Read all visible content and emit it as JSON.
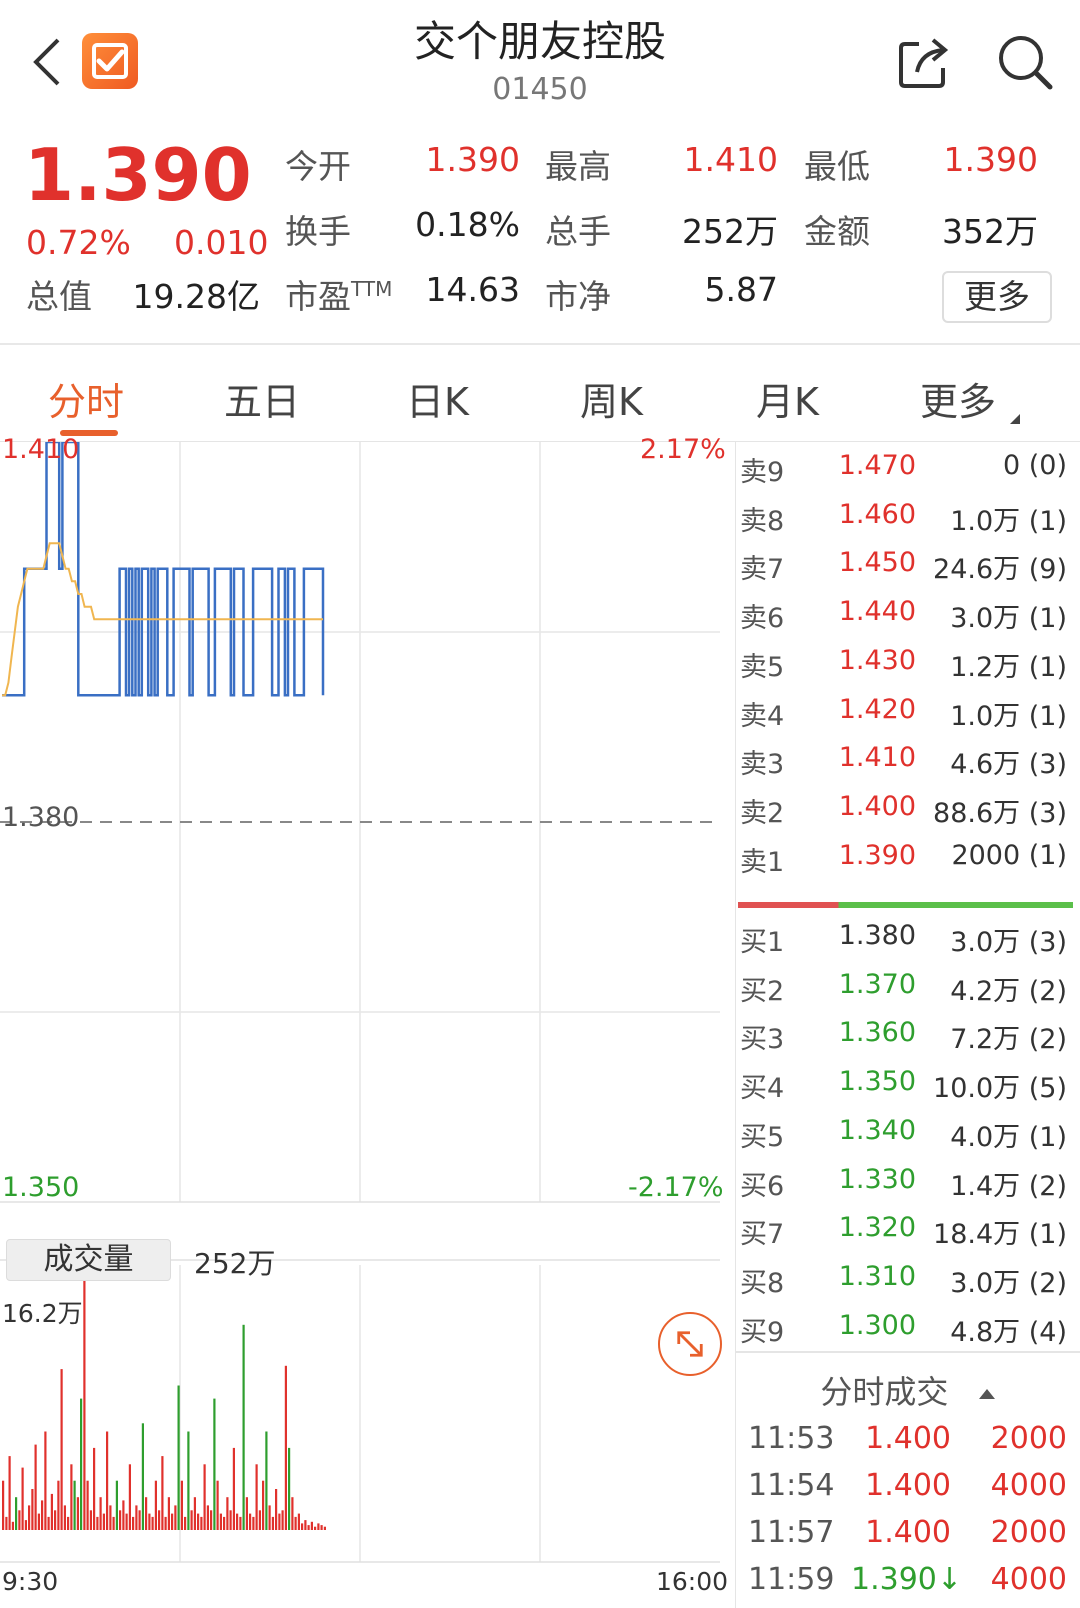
{
  "header": {
    "title": "交个朋友控股",
    "code": "01450"
  },
  "quote": {
    "price": "1.390",
    "change_pct": "0.72%",
    "change": "0.010",
    "fields": [
      {
        "label": "今开",
        "value": "1.390",
        "color": "red"
      },
      {
        "label": "最高",
        "value": "1.410",
        "color": "red"
      },
      {
        "label": "最低",
        "value": "1.390",
        "color": "red"
      },
      {
        "label": "换手",
        "value": "0.18%",
        "color": "dark"
      },
      {
        "label": "总手",
        "value": "252万",
        "color": "dark"
      },
      {
        "label": "金额",
        "value": "352万",
        "color": "dark"
      },
      {
        "label": "总值",
        "value": "19.28亿",
        "color": "dark"
      },
      {
        "label": "市盈TTM",
        "value": "14.63",
        "color": "dark"
      },
      {
        "label": "市净",
        "value": "5.87",
        "color": "dark"
      }
    ],
    "more_label": "更多"
  },
  "tabs": [
    "分时",
    "五日",
    "日K",
    "周K",
    "月K",
    "更多"
  ],
  "chart": {
    "price_high": "1.410",
    "price_mid": "1.380",
    "price_low": "1.350",
    "pct_high": "2.17%",
    "pct_low": "-2.17%",
    "volume_label": "成交量",
    "volume_total": "252万",
    "volume_max": "16.2万",
    "time_start": "9:30",
    "time_end": "16:00"
  },
  "chart_data": {
    "type": "line",
    "ylim": [
      1.35,
      1.41
    ],
    "series": [
      {
        "values": [
          1.39,
          1.39,
          1.39,
          1.39,
          1.39,
          1.39,
          1.39,
          1.4,
          1.4,
          1.4,
          1.4,
          1.4,
          1.4,
          1.4,
          1.41,
          1.41,
          1.41,
          1.41,
          1.4,
          1.41,
          1.41,
          1.41,
          1.41,
          1.41,
          1.39,
          1.39,
          1.39,
          1.39,
          1.39,
          1.39,
          1.39,
          1.39,
          1.39,
          1.39,
          1.39,
          1.39,
          1.39,
          1.4,
          1.4,
          1.39,
          1.4,
          1.39,
          1.4,
          1.39,
          1.4,
          1.4,
          1.39,
          1.4,
          1.39,
          1.4,
          1.4,
          1.4,
          1.39,
          1.39,
          1.4,
          1.4,
          1.4,
          1.4,
          1.4,
          1.39,
          1.4,
          1.4,
          1.4,
          1.4,
          1.4,
          1.39,
          1.39,
          1.4,
          1.4,
          1.4,
          1.4,
          1.4,
          1.39,
          1.4,
          1.4,
          1.4,
          1.39,
          1.39,
          1.39,
          1.4,
          1.4,
          1.4,
          1.4,
          1.4,
          1.4,
          1.39,
          1.39,
          1.4,
          1.4,
          1.39,
          1.4,
          1.4,
          1.39,
          1.39,
          1.39,
          1.4,
          1.4,
          1.4,
          1.4,
          1.4,
          1.4,
          1.39
        ],
        "color": "#3a6fc4"
      },
      {
        "values": [
          1.39,
          1.39,
          1.391,
          1.393,
          1.395,
          1.397,
          1.398,
          1.399,
          1.4,
          1.4,
          1.4,
          1.4,
          1.4,
          1.4,
          1.401,
          1.402,
          1.402,
          1.402,
          1.402,
          1.401,
          1.4,
          1.4,
          1.399,
          1.399,
          1.398,
          1.398,
          1.397,
          1.397,
          1.397,
          1.396,
          1.396,
          1.396,
          1.396,
          1.396,
          1.396,
          1.396,
          1.396,
          1.396,
          1.396,
          1.396,
          1.396,
          1.396,
          1.396,
          1.396,
          1.396,
          1.396,
          1.396,
          1.396,
          1.396,
          1.396,
          1.396,
          1.396,
          1.396,
          1.396,
          1.396,
          1.396,
          1.396,
          1.396,
          1.396,
          1.396,
          1.396,
          1.396,
          1.396,
          1.396,
          1.396,
          1.396,
          1.396,
          1.396,
          1.396,
          1.396,
          1.396,
          1.396,
          1.396,
          1.396,
          1.396,
          1.396,
          1.396,
          1.396,
          1.396,
          1.396,
          1.396,
          1.396,
          1.396,
          1.396,
          1.396,
          1.396,
          1.396,
          1.396,
          1.396,
          1.396,
          1.396,
          1.396,
          1.396,
          1.396,
          1.396,
          1.396,
          1.396,
          1.396,
          1.396,
          1.396,
          1.396,
          1.396
        ],
        "color": "#f0b650"
      }
    ],
    "volume_max": 162000,
    "volumes": [
      {
        "v": 30000,
        "c": "r"
      },
      {
        "v": 8000,
        "c": "r"
      },
      {
        "v": 45000,
        "c": "r"
      },
      {
        "v": 5000,
        "c": "r"
      },
      {
        "v": 20000,
        "c": "g"
      },
      {
        "v": 12000,
        "c": "r"
      },
      {
        "v": 38000,
        "c": "r"
      },
      {
        "v": 6000,
        "c": "r"
      },
      {
        "v": 15000,
        "c": "r"
      },
      {
        "v": 25000,
        "c": "r"
      },
      {
        "v": 52000,
        "c": "r"
      },
      {
        "v": 10000,
        "c": "r"
      },
      {
        "v": 18000,
        "c": "r"
      },
      {
        "v": 60000,
        "c": "r"
      },
      {
        "v": 8000,
        "c": "r"
      },
      {
        "v": 22000,
        "c": "r"
      },
      {
        "v": 12000,
        "c": "r"
      },
      {
        "v": 30000,
        "c": "r"
      },
      {
        "v": 98000,
        "c": "r"
      },
      {
        "v": 15000,
        "c": "r"
      },
      {
        "v": 8000,
        "c": "r"
      },
      {
        "v": 40000,
        "c": "r"
      },
      {
        "v": 30000,
        "c": "g"
      },
      {
        "v": 20000,
        "c": "r"
      },
      {
        "v": 80000,
        "c": "g"
      },
      {
        "v": 162000,
        "c": "r"
      },
      {
        "v": 30000,
        "c": "r"
      },
      {
        "v": 12000,
        "c": "r"
      },
      {
        "v": 50000,
        "c": "r"
      },
      {
        "v": 8000,
        "c": "r"
      },
      {
        "v": 20000,
        "c": "r"
      },
      {
        "v": 10000,
        "c": "r"
      },
      {
        "v": 60000,
        "c": "r"
      },
      {
        "v": 15000,
        "c": "r"
      },
      {
        "v": 8000,
        "c": "r"
      },
      {
        "v": 30000,
        "c": "g"
      },
      {
        "v": 12000,
        "c": "r"
      },
      {
        "v": 18000,
        "c": "r"
      },
      {
        "v": 10000,
        "c": "r"
      },
      {
        "v": 40000,
        "c": "r"
      },
      {
        "v": 8000,
        "c": "r"
      },
      {
        "v": 15000,
        "c": "r"
      },
      {
        "v": 12000,
        "c": "r"
      },
      {
        "v": 65000,
        "c": "g"
      },
      {
        "v": 20000,
        "c": "r"
      },
      {
        "v": 10000,
        "c": "r"
      },
      {
        "v": 8000,
        "c": "r"
      },
      {
        "v": 30000,
        "c": "r"
      },
      {
        "v": 12000,
        "c": "r"
      },
      {
        "v": 45000,
        "c": "r"
      },
      {
        "v": 8000,
        "c": "r"
      },
      {
        "v": 20000,
        "c": "r"
      },
      {
        "v": 10000,
        "c": "r"
      },
      {
        "v": 15000,
        "c": "r"
      },
      {
        "v": 88000,
        "c": "g"
      },
      {
        "v": 30000,
        "c": "r"
      },
      {
        "v": 8000,
        "c": "r"
      },
      {
        "v": 60000,
        "c": "g"
      },
      {
        "v": 12000,
        "c": "r"
      },
      {
        "v": 20000,
        "c": "r"
      },
      {
        "v": 10000,
        "c": "r"
      },
      {
        "v": 8000,
        "c": "r"
      },
      {
        "v": 40000,
        "c": "r"
      },
      {
        "v": 15000,
        "c": "r"
      },
      {
        "v": 12000,
        "c": "r"
      },
      {
        "v": 80000,
        "c": "g"
      },
      {
        "v": 30000,
        "c": "r"
      },
      {
        "v": 10000,
        "c": "r"
      },
      {
        "v": 8000,
        "c": "r"
      },
      {
        "v": 20000,
        "c": "r"
      },
      {
        "v": 12000,
        "c": "r"
      },
      {
        "v": 50000,
        "c": "r"
      },
      {
        "v": 10000,
        "c": "r"
      },
      {
        "v": 8000,
        "c": "r"
      },
      {
        "v": 125000,
        "c": "g"
      },
      {
        "v": 20000,
        "c": "r"
      },
      {
        "v": 10000,
        "c": "r"
      },
      {
        "v": 8000,
        "c": "r"
      },
      {
        "v": 40000,
        "c": "r"
      },
      {
        "v": 12000,
        "c": "r"
      },
      {
        "v": 30000,
        "c": "r"
      },
      {
        "v": 60000,
        "c": "g"
      },
      {
        "v": 15000,
        "c": "r"
      },
      {
        "v": 8000,
        "c": "r"
      },
      {
        "v": 25000,
        "c": "r"
      },
      {
        "v": 10000,
        "c": "r"
      },
      {
        "v": 12000,
        "c": "r"
      },
      {
        "v": 100000,
        "c": "r"
      },
      {
        "v": 50000,
        "c": "g"
      },
      {
        "v": 20000,
        "c": "r"
      },
      {
        "v": 8000,
        "c": "r"
      },
      {
        "v": 10000,
        "c": "r"
      },
      {
        "v": 4000,
        "c": "r"
      },
      {
        "v": 6000,
        "c": "r"
      },
      {
        "v": 3000,
        "c": "r"
      },
      {
        "v": 5000,
        "c": "r"
      },
      {
        "v": 2000,
        "c": "r"
      },
      {
        "v": 4000,
        "c": "r"
      },
      {
        "v": 3000,
        "c": "r"
      },
      {
        "v": 2000,
        "c": "r"
      }
    ]
  },
  "order_book": {
    "asks": [
      {
        "label": "卖9",
        "price": "1.470",
        "vol": "0 (0)",
        "color": "red"
      },
      {
        "label": "卖8",
        "price": "1.460",
        "vol": "1.0万 (1)",
        "color": "red"
      },
      {
        "label": "卖7",
        "price": "1.450",
        "vol": "24.6万 (9)",
        "color": "red"
      },
      {
        "label": "卖6",
        "price": "1.440",
        "vol": "3.0万 (1)",
        "color": "red"
      },
      {
        "label": "卖5",
        "price": "1.430",
        "vol": "1.2万 (1)",
        "color": "red"
      },
      {
        "label": "卖4",
        "price": "1.420",
        "vol": "1.0万 (1)",
        "color": "red"
      },
      {
        "label": "卖3",
        "price": "1.410",
        "vol": "4.6万 (3)",
        "color": "red"
      },
      {
        "label": "卖2",
        "price": "1.400",
        "vol": "88.6万 (3)",
        "color": "red"
      },
      {
        "label": "卖1",
        "price": "1.390",
        "vol": "2000 (1)",
        "color": "red"
      }
    ],
    "bids": [
      {
        "label": "买1",
        "price": "1.380",
        "vol": "3.0万 (3)",
        "color": "dark"
      },
      {
        "label": "买2",
        "price": "1.370",
        "vol": "4.2万 (2)",
        "color": "green"
      },
      {
        "label": "买3",
        "price": "1.360",
        "vol": "7.2万 (2)",
        "color": "green"
      },
      {
        "label": "买4",
        "price": "1.350",
        "vol": "10.0万 (5)",
        "color": "green"
      },
      {
        "label": "买5",
        "price": "1.340",
        "vol": "4.0万 (1)",
        "color": "green"
      },
      {
        "label": "买6",
        "price": "1.330",
        "vol": "1.4万 (2)",
        "color": "green"
      },
      {
        "label": "买7",
        "price": "1.320",
        "vol": "18.4万 (1)",
        "color": "green"
      },
      {
        "label": "买8",
        "price": "1.310",
        "vol": "3.0万 (2)",
        "color": "green"
      },
      {
        "label": "买9",
        "price": "1.300",
        "vol": "4.8万 (4)",
        "color": "green"
      }
    ],
    "sell_ratio": 0.3
  },
  "trades": {
    "title": "分时成交",
    "rows": [
      {
        "time": "11:53",
        "price": "1.400",
        "vol": "2000"
      },
      {
        "time": "11:54",
        "price": "1.400",
        "vol": "4000"
      },
      {
        "time": "11:57",
        "price": "1.400",
        "vol": "2000"
      },
      {
        "time": "11:59",
        "price": "1.390↓",
        "vol": "4000"
      }
    ]
  },
  "colors": {
    "up": "#e0312c",
    "down": "#2e9e2e",
    "accent": "#e8602c",
    "price_line": "#3a6fc4",
    "avg_line": "#f0b650"
  },
  "icons": [
    "back-arrow-icon",
    "app-logo-icon",
    "share-icon",
    "search-icon",
    "expand-icon",
    "caret-up-icon",
    "dropdown-triangle-icon"
  ]
}
